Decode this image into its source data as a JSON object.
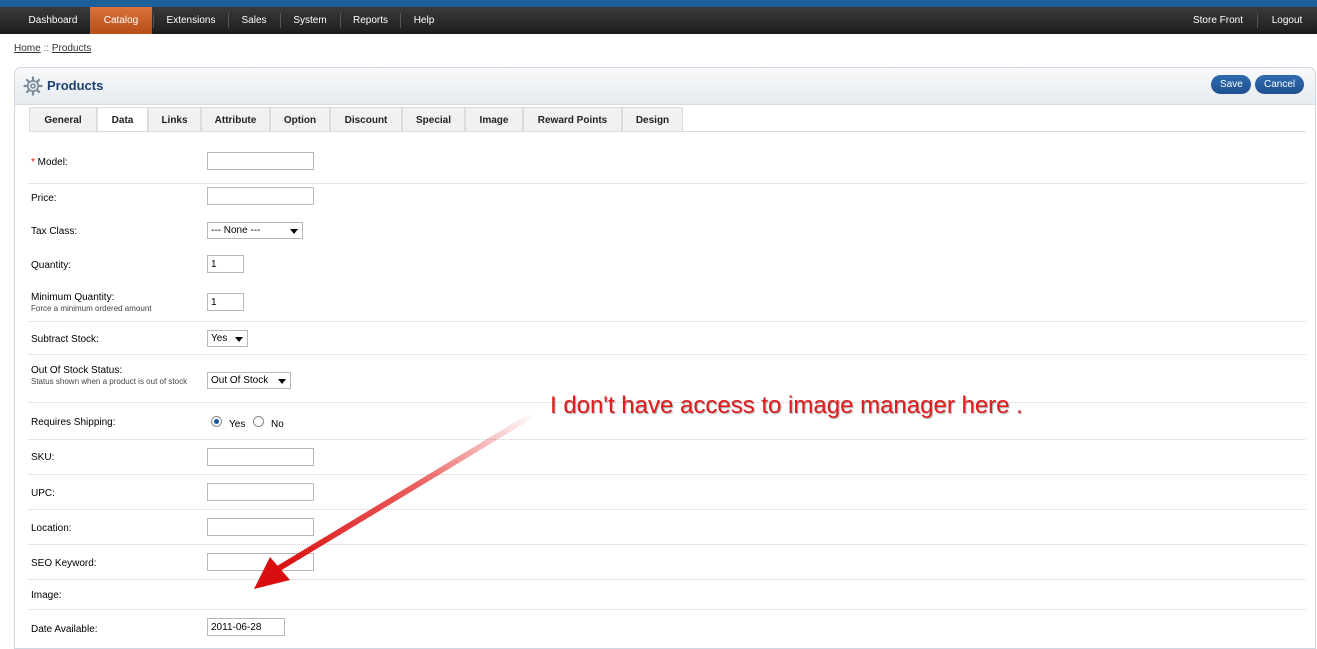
{
  "menu": {
    "left": [
      {
        "label": "Dashboard",
        "active": false
      },
      {
        "label": "Catalog",
        "active": true
      },
      {
        "label": "Extensions",
        "active": false
      },
      {
        "label": "Sales",
        "active": false
      },
      {
        "label": "System",
        "active": false
      },
      {
        "label": "Reports",
        "active": false
      },
      {
        "label": "Help",
        "active": false
      }
    ],
    "right": [
      {
        "label": "Store Front"
      },
      {
        "label": "Logout"
      }
    ],
    "active_color": "#c65a22"
  },
  "breadcrumb": {
    "home": "Home",
    "separator": " :: ",
    "current": "Products"
  },
  "panel": {
    "title": "Products",
    "icon": "gear-icon",
    "save_label": "Save",
    "cancel_label": "Cancel"
  },
  "tabs": [
    {
      "label": "General",
      "active": false
    },
    {
      "label": "Data",
      "active": true
    },
    {
      "label": "Links",
      "active": false
    },
    {
      "label": "Attribute",
      "active": false
    },
    {
      "label": "Option",
      "active": false
    },
    {
      "label": "Discount",
      "active": false
    },
    {
      "label": "Special",
      "active": false
    },
    {
      "label": "Image",
      "active": false
    },
    {
      "label": "Reward Points",
      "active": false
    },
    {
      "label": "Design",
      "active": false
    }
  ],
  "form": {
    "model": {
      "required_mark": "*",
      "label": " Model:",
      "value": ""
    },
    "price": {
      "label": "Price:",
      "value": ""
    },
    "tax_class": {
      "label": "Tax Class:",
      "value": "--- None ---"
    },
    "quantity": {
      "label": "Quantity:",
      "value": "1"
    },
    "minimum": {
      "label": "Minimum Quantity:",
      "help": "Force a minimum ordered amount",
      "value": "1"
    },
    "subtract": {
      "label": "Subtract Stock:",
      "value": "Yes"
    },
    "stock_status": {
      "label": "Out Of Stock Status:",
      "help": "Status shown when a product is out of stock",
      "value": "Out Of Stock"
    },
    "shipping": {
      "label": "Requires Shipping:",
      "yes": "Yes",
      "no": "No",
      "selected": "Yes"
    },
    "sku": {
      "label": "SKU:",
      "value": ""
    },
    "upc": {
      "label": "UPC:",
      "value": ""
    },
    "location": {
      "label": "Location:",
      "value": ""
    },
    "seo": {
      "label": "SEO Keyword:",
      "value": ""
    },
    "image": {
      "label": "Image:"
    },
    "date_available": {
      "label": "Date Available:",
      "value": "2011-06-28"
    }
  },
  "annotation": {
    "text": "I don't have access to image manager here .",
    "color": "#e31b1b"
  }
}
